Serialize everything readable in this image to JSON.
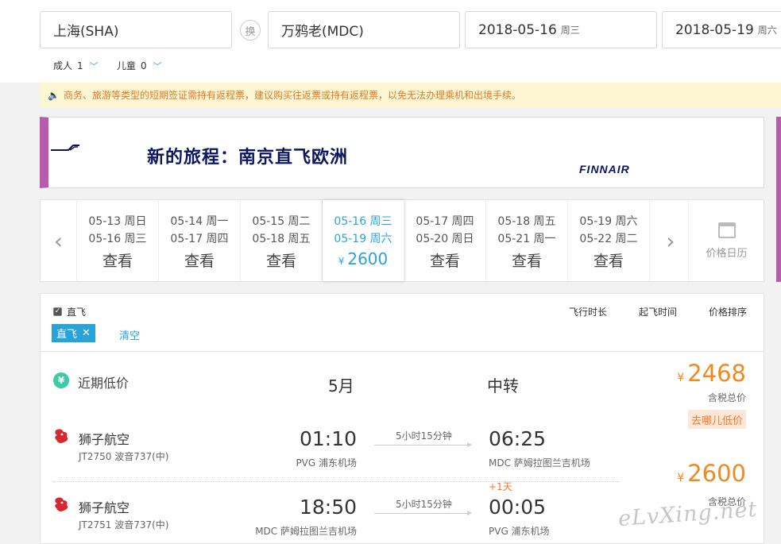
{
  "search": {
    "from": "上海(SHA)",
    "swap_label": "换",
    "to": "万鸦老(MDC)",
    "depart_date": "2018-05-16",
    "depart_weekday": "周三",
    "return_date": "2018-05-19",
    "return_weekday": "周六",
    "adults_label": "成人",
    "adults_count": "1",
    "children_label": "儿童",
    "children_count": "0"
  },
  "notice": {
    "icon": "speaker-icon",
    "text": "商务、旅游等类型的短期签证需持有返程票，建议购买往返票或持有返程票，以免无法办理乘机和出境手续。"
  },
  "banner": {
    "title": "新的旅程：南京直飞欧洲",
    "brand": "FINNAIR",
    "border_color": "#b85bad"
  },
  "date_strip": {
    "cells": [
      {
        "out": "05-13 周日",
        "ret": "05-16 周三",
        "action": "查看"
      },
      {
        "out": "05-14 周一",
        "ret": "05-17 周四",
        "action": "查看"
      },
      {
        "out": "05-15 周二",
        "ret": "05-18 周五",
        "action": "查看"
      },
      {
        "out": "05-16 周三",
        "ret": "05-19 周六",
        "currency": "¥",
        "price": "2600"
      },
      {
        "out": "05-17 周四",
        "ret": "05-20 周日",
        "action": "查看"
      },
      {
        "out": "05-18 周五",
        "ret": "05-21 周一",
        "action": "查看"
      },
      {
        "out": "05-19 周六",
        "ret": "05-22 周二",
        "action": "查看"
      }
    ],
    "calendar_label": "价格日历"
  },
  "filters": {
    "direct_label": "直飞",
    "tag_label": "直飞",
    "clear_label": "清空",
    "sort_duration": "飞行时长",
    "sort_departure": "起飞时间",
    "sort_price": "价格排序"
  },
  "low_price": {
    "label": "近期低价",
    "month": "5月",
    "transfer": "中转",
    "currency": "¥",
    "price": "2468",
    "price_note": "含税总价",
    "badge": "去哪儿低价"
  },
  "flights": [
    {
      "airline": "狮子航空",
      "code": "JT2750 波音737(中)",
      "dep_time": "01:10",
      "dep_airport": "PVG 浦东机场",
      "duration": "5小时15分钟",
      "arr_time": "06:25",
      "arr_airport": "MDC 萨姆拉图兰吉机场",
      "next_day": ""
    },
    {
      "airline": "狮子航空",
      "code": "JT2751 波音737(中)",
      "dep_time": "18:50",
      "dep_airport": "MDC 萨姆拉图兰吉机场",
      "duration": "5小时15分钟",
      "arr_time": "00:05",
      "arr_airport": "PVG 浦东机场",
      "next_day": "+1天"
    }
  ],
  "combo_price": {
    "currency": "¥",
    "price": "2600",
    "price_note": "含税总价"
  },
  "watermark": "eLvXing.net",
  "colors": {
    "accent_blue": "#2aa4d8",
    "price_orange": "#f08a1f",
    "notice_bg": "#fdf6d3",
    "icon_green": "#3ccba3",
    "airline_red": "#d8282f"
  }
}
